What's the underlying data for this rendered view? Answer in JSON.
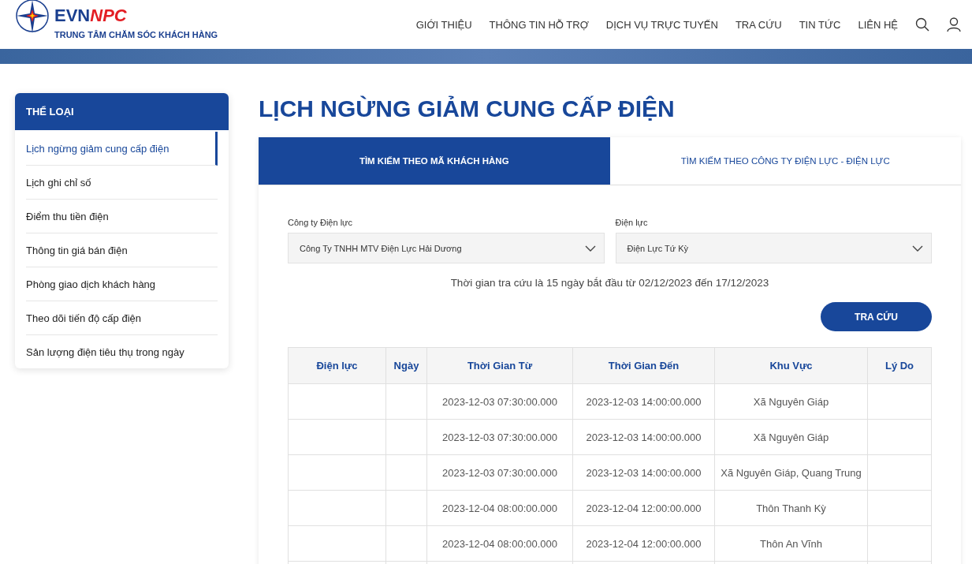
{
  "header": {
    "logo": {
      "brand_main": "EVN",
      "brand_accent": "NPC",
      "tagline": "TRUNG TÂM CHĂM SÓC KHÁCH HÀNG"
    },
    "nav": [
      "GIỚI THIỆU",
      "THÔNG TIN HỖ TRỢ",
      "DỊCH VỤ TRỰC TUYẾN",
      "TRA CỨU",
      "TIN TỨC",
      "LIÊN HỆ"
    ]
  },
  "sidebar": {
    "title": "THỂ LOẠI",
    "items": [
      {
        "label": "Lịch ngừng giảm cung cấp điện",
        "selected": true
      },
      {
        "label": "Lịch ghi chỉ số",
        "selected": false
      },
      {
        "label": "Điểm thu tiền điện",
        "selected": false
      },
      {
        "label": "Thông tin giá bán điện",
        "selected": false
      },
      {
        "label": "Phòng giao dịch khách hàng",
        "selected": false
      },
      {
        "label": "Theo dõi tiến độ cấp điện",
        "selected": false
      },
      {
        "label": "Sản lượng điện tiêu thụ trong ngày",
        "selected": false
      }
    ]
  },
  "page_title": "LỊCH NGỪNG GIẢM CUNG CẤP ĐIỆN",
  "tabs": [
    {
      "label": "TÌM KIẾM THEO MÃ KHÁCH HÀNG",
      "selected": true
    },
    {
      "label": "TÌM KIẾM THEO CÔNG TY ĐIỆN LỰC - ĐIỆN LỰC",
      "selected": false
    }
  ],
  "form": {
    "fields": [
      {
        "label": "Công ty Điện lực",
        "value": "Công Ty TNHH MTV Điện Lực Hải Dương"
      },
      {
        "label": "Điện lực",
        "value": "Điện Lực Tứ Kỳ"
      }
    ],
    "note": "Thời gian tra cứu là 15 ngày bắt đầu từ 02/12/2023 đến 17/12/2023",
    "button": "TRA CỨU"
  },
  "table": {
    "columns": [
      "Điện lực",
      "Ngày",
      "Thời Gian Từ",
      "Thời Gian Đến",
      "Khu Vực",
      "Lý Do"
    ],
    "rows": [
      {
        "from": "2023-12-03 07:30:00.000",
        "to": "2023-12-03 14:00:00.000",
        "area": "Xã Nguyên Giáp"
      },
      {
        "from": "2023-12-03 07:30:00.000",
        "to": "2023-12-03 14:00:00.000",
        "area": "Xã Nguyên Giáp"
      },
      {
        "from": "2023-12-03 07:30:00.000",
        "to": "2023-12-03 14:00:00.000",
        "area": "Xã Nguyên Giáp, Quang Trung"
      },
      {
        "from": "2023-12-04 08:00:00.000",
        "to": "2023-12-04 12:00:00.000",
        "area": "Thôn Thanh Kỳ"
      },
      {
        "from": "2023-12-04 08:00:00.000",
        "to": "2023-12-04 12:00:00.000",
        "area": "Thôn An Vĩnh"
      }
    ]
  }
}
